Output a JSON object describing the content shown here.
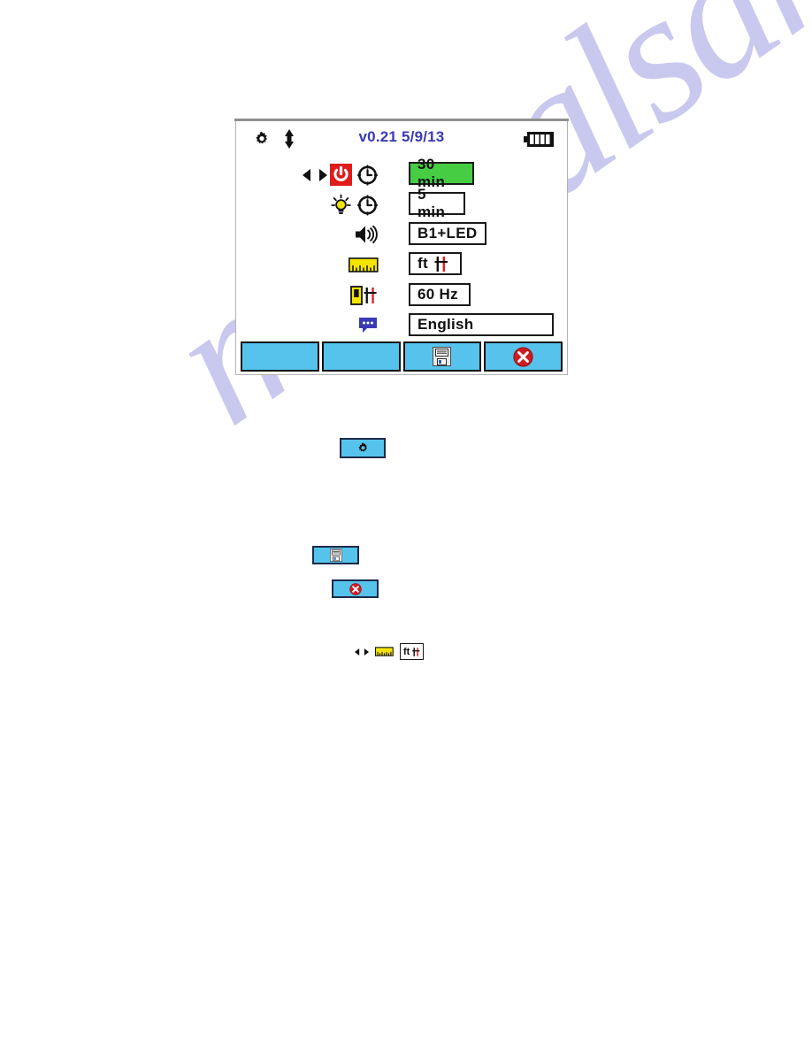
{
  "page": {
    "watermark_text": "manualsarchive.com",
    "watermark_color": "#c9c9ef",
    "background_color": "#ffffff"
  },
  "device": {
    "screen_background": "#ffffff",
    "frame_border_color": "#b3b3b3",
    "status_bar": {
      "gear_icon": "gear-icon",
      "updown_icon": "up-down-arrows-icon",
      "title": "v0.21 5/9/13",
      "title_color": "#3a3ab5",
      "battery_icon": "battery-full-icon",
      "battery_bars": 4
    },
    "cursor": {
      "left_right_icon": "left-right-arrows-icon"
    },
    "settings_rows": [
      {
        "name": "auto-power-off",
        "icons": [
          "power-off-icon",
          "clock-icon"
        ],
        "value": "30 min",
        "selected": true,
        "field_width": 74
      },
      {
        "name": "backlight-timeout",
        "icons": [
          "lightbulb-icon",
          "clock-icon"
        ],
        "value": "5 min",
        "selected": false,
        "field_width": 64
      },
      {
        "name": "sound-alert",
        "icons": [
          "speaker-icon"
        ],
        "value": "B1+LED",
        "selected": false,
        "field_width": 88
      },
      {
        "name": "measurement-units",
        "icons": [
          "ruler-icon"
        ],
        "value": "ft",
        "value_suffix_icon": "rebar-bars-icon",
        "selected": false,
        "field_width": 60
      },
      {
        "name": "line-frequency",
        "icons": [
          "device-bars-icon"
        ],
        "value": "60 Hz",
        "selected": false,
        "field_width": 70
      },
      {
        "name": "language",
        "icons": [
          "speech-bubble-icon"
        ],
        "value": "English",
        "selected": false,
        "field_width": 164
      }
    ],
    "softkeys": [
      {
        "name": "softkey-1",
        "label": "",
        "icon": ""
      },
      {
        "name": "softkey-2",
        "label": "",
        "icon": ""
      },
      {
        "name": "softkey-save",
        "label": "",
        "icon": "floppy-save-icon"
      },
      {
        "name": "softkey-cancel",
        "label": "",
        "icon": "red-x-cancel-icon"
      }
    ],
    "colors": {
      "selected_field": "#46cd44",
      "softkey": "#56c3ec",
      "power_icon_red": "#e01b1b",
      "ruler_yellow": "#f5e400",
      "cancel_red": "#d11a22",
      "bubble_blue": "#3a3ab5"
    }
  },
  "callouts": [
    {
      "name": "callout-gear-button",
      "icon": "gear-icon"
    },
    {
      "name": "callout-save-button",
      "icon": "floppy-save-icon"
    },
    {
      "name": "callout-cancel-button",
      "icon": "red-x-cancel-icon"
    },
    {
      "name": "callout-units-row",
      "icons": [
        "left-right-arrows-icon",
        "ruler-icon"
      ],
      "value": "ft",
      "value_suffix_icon": "rebar-bars-icon"
    }
  ]
}
